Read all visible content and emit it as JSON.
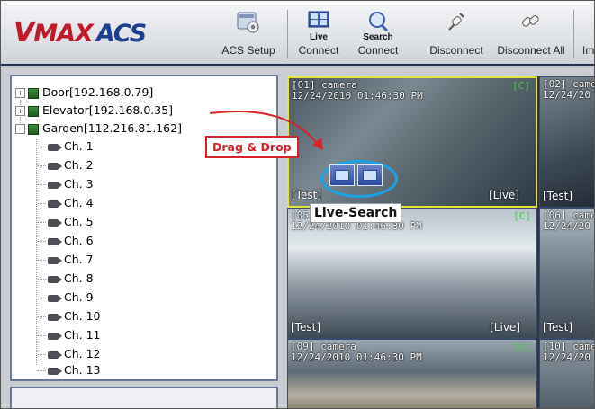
{
  "logo": {
    "v": "V",
    "rest": "MAX",
    "acs": "ACS"
  },
  "toolbar": {
    "buttons": [
      {
        "label": "ACS Setup",
        "icon": "acs-setup-gear-icon"
      },
      {
        "label": "Connect",
        "sublabel": "Live",
        "icon": "live-connect-icon"
      },
      {
        "label": "Connect",
        "sublabel": "Search",
        "icon": "search-connect-icon"
      },
      {
        "label": "Disconnect",
        "icon": "disconnect-plug-icon"
      },
      {
        "label": "Disconnect All",
        "icon": "disconnect-all-plug-icon"
      },
      {
        "label": "Im"
      }
    ]
  },
  "tree": {
    "sites": [
      {
        "label": "Door[192.168.0.79]",
        "expander": "+"
      },
      {
        "label": "Elevator[192.168.0.35]",
        "expander": "+"
      },
      {
        "label": "Garden[112.216.81.162]",
        "expander": "-"
      }
    ],
    "channels": [
      "Ch.  1",
      "Ch.  2",
      "Ch.  3",
      "Ch.  4",
      "Ch.  5",
      "Ch.  6",
      "Ch.  7",
      "Ch.  8",
      "Ch.  9",
      "Ch.  10",
      "Ch.  11",
      "Ch.  12",
      "Ch.  13"
    ]
  },
  "tiles": [
    {
      "title": "[01] camera",
      "time": "12/24/2010 01:46:30 PM",
      "flag": "[C]",
      "left": "[Test]",
      "right": "[Live]"
    },
    {
      "title": "[02] came",
      "time": "12/24/20",
      "flag": "",
      "left": "[Test]",
      "right": ""
    },
    {
      "title": "[05",
      "time": "12/24/2010 01:46:30 PM",
      "flag": "[C]",
      "left": "[Test]",
      "right": "[Live]"
    },
    {
      "title": "[06] came",
      "time": "12/24/20",
      "flag": "",
      "left": "[Test]",
      "right": ""
    },
    {
      "title": "[09] camera",
      "time": "12/24/2010 01:46:30 PM",
      "flag": "[C]",
      "left": "",
      "right": ""
    },
    {
      "title": "[10] came",
      "time": "12/24/20",
      "flag": "",
      "left": "",
      "right": ""
    }
  ],
  "annotations": {
    "drag_drop": "Drag & Drop",
    "live_search": "Live-Search"
  },
  "colors": {
    "highlight_tile": "#e8e23a",
    "annotation_red": "#d6232a",
    "annotation_blue": "#1aa3e6"
  }
}
